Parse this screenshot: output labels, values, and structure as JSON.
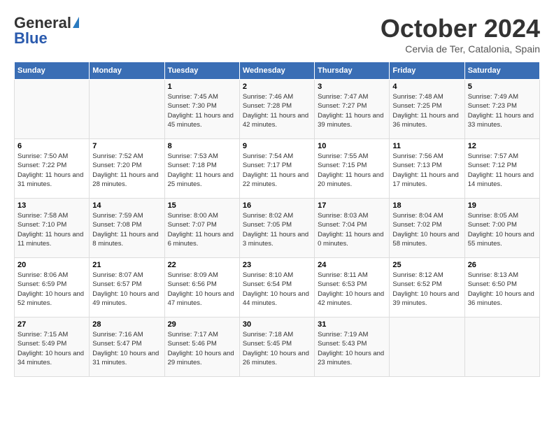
{
  "header": {
    "logo_general": "General",
    "logo_blue": "Blue",
    "month_title": "October 2024",
    "location": "Cervia de Ter, Catalonia, Spain"
  },
  "weekdays": [
    "Sunday",
    "Monday",
    "Tuesday",
    "Wednesday",
    "Thursday",
    "Friday",
    "Saturday"
  ],
  "weeks": [
    [
      {
        "day": "",
        "sunrise": "",
        "sunset": "",
        "daylight": ""
      },
      {
        "day": "",
        "sunrise": "",
        "sunset": "",
        "daylight": ""
      },
      {
        "day": "1",
        "sunrise": "Sunrise: 7:45 AM",
        "sunset": "Sunset: 7:30 PM",
        "daylight": "Daylight: 11 hours and 45 minutes."
      },
      {
        "day": "2",
        "sunrise": "Sunrise: 7:46 AM",
        "sunset": "Sunset: 7:28 PM",
        "daylight": "Daylight: 11 hours and 42 minutes."
      },
      {
        "day": "3",
        "sunrise": "Sunrise: 7:47 AM",
        "sunset": "Sunset: 7:27 PM",
        "daylight": "Daylight: 11 hours and 39 minutes."
      },
      {
        "day": "4",
        "sunrise": "Sunrise: 7:48 AM",
        "sunset": "Sunset: 7:25 PM",
        "daylight": "Daylight: 11 hours and 36 minutes."
      },
      {
        "day": "5",
        "sunrise": "Sunrise: 7:49 AM",
        "sunset": "Sunset: 7:23 PM",
        "daylight": "Daylight: 11 hours and 33 minutes."
      }
    ],
    [
      {
        "day": "6",
        "sunrise": "Sunrise: 7:50 AM",
        "sunset": "Sunset: 7:22 PM",
        "daylight": "Daylight: 11 hours and 31 minutes."
      },
      {
        "day": "7",
        "sunrise": "Sunrise: 7:52 AM",
        "sunset": "Sunset: 7:20 PM",
        "daylight": "Daylight: 11 hours and 28 minutes."
      },
      {
        "day": "8",
        "sunrise": "Sunrise: 7:53 AM",
        "sunset": "Sunset: 7:18 PM",
        "daylight": "Daylight: 11 hours and 25 minutes."
      },
      {
        "day": "9",
        "sunrise": "Sunrise: 7:54 AM",
        "sunset": "Sunset: 7:17 PM",
        "daylight": "Daylight: 11 hours and 22 minutes."
      },
      {
        "day": "10",
        "sunrise": "Sunrise: 7:55 AM",
        "sunset": "Sunset: 7:15 PM",
        "daylight": "Daylight: 11 hours and 20 minutes."
      },
      {
        "day": "11",
        "sunrise": "Sunrise: 7:56 AM",
        "sunset": "Sunset: 7:13 PM",
        "daylight": "Daylight: 11 hours and 17 minutes."
      },
      {
        "day": "12",
        "sunrise": "Sunrise: 7:57 AM",
        "sunset": "Sunset: 7:12 PM",
        "daylight": "Daylight: 11 hours and 14 minutes."
      }
    ],
    [
      {
        "day": "13",
        "sunrise": "Sunrise: 7:58 AM",
        "sunset": "Sunset: 7:10 PM",
        "daylight": "Daylight: 11 hours and 11 minutes."
      },
      {
        "day": "14",
        "sunrise": "Sunrise: 7:59 AM",
        "sunset": "Sunset: 7:08 PM",
        "daylight": "Daylight: 11 hours and 8 minutes."
      },
      {
        "day": "15",
        "sunrise": "Sunrise: 8:00 AM",
        "sunset": "Sunset: 7:07 PM",
        "daylight": "Daylight: 11 hours and 6 minutes."
      },
      {
        "day": "16",
        "sunrise": "Sunrise: 8:02 AM",
        "sunset": "Sunset: 7:05 PM",
        "daylight": "Daylight: 11 hours and 3 minutes."
      },
      {
        "day": "17",
        "sunrise": "Sunrise: 8:03 AM",
        "sunset": "Sunset: 7:04 PM",
        "daylight": "Daylight: 11 hours and 0 minutes."
      },
      {
        "day": "18",
        "sunrise": "Sunrise: 8:04 AM",
        "sunset": "Sunset: 7:02 PM",
        "daylight": "Daylight: 10 hours and 58 minutes."
      },
      {
        "day": "19",
        "sunrise": "Sunrise: 8:05 AM",
        "sunset": "Sunset: 7:00 PM",
        "daylight": "Daylight: 10 hours and 55 minutes."
      }
    ],
    [
      {
        "day": "20",
        "sunrise": "Sunrise: 8:06 AM",
        "sunset": "Sunset: 6:59 PM",
        "daylight": "Daylight: 10 hours and 52 minutes."
      },
      {
        "day": "21",
        "sunrise": "Sunrise: 8:07 AM",
        "sunset": "Sunset: 6:57 PM",
        "daylight": "Daylight: 10 hours and 49 minutes."
      },
      {
        "day": "22",
        "sunrise": "Sunrise: 8:09 AM",
        "sunset": "Sunset: 6:56 PM",
        "daylight": "Daylight: 10 hours and 47 minutes."
      },
      {
        "day": "23",
        "sunrise": "Sunrise: 8:10 AM",
        "sunset": "Sunset: 6:54 PM",
        "daylight": "Daylight: 10 hours and 44 minutes."
      },
      {
        "day": "24",
        "sunrise": "Sunrise: 8:11 AM",
        "sunset": "Sunset: 6:53 PM",
        "daylight": "Daylight: 10 hours and 42 minutes."
      },
      {
        "day": "25",
        "sunrise": "Sunrise: 8:12 AM",
        "sunset": "Sunset: 6:52 PM",
        "daylight": "Daylight: 10 hours and 39 minutes."
      },
      {
        "day": "26",
        "sunrise": "Sunrise: 8:13 AM",
        "sunset": "Sunset: 6:50 PM",
        "daylight": "Daylight: 10 hours and 36 minutes."
      }
    ],
    [
      {
        "day": "27",
        "sunrise": "Sunrise: 7:15 AM",
        "sunset": "Sunset: 5:49 PM",
        "daylight": "Daylight: 10 hours and 34 minutes."
      },
      {
        "day": "28",
        "sunrise": "Sunrise: 7:16 AM",
        "sunset": "Sunset: 5:47 PM",
        "daylight": "Daylight: 10 hours and 31 minutes."
      },
      {
        "day": "29",
        "sunrise": "Sunrise: 7:17 AM",
        "sunset": "Sunset: 5:46 PM",
        "daylight": "Daylight: 10 hours and 29 minutes."
      },
      {
        "day": "30",
        "sunrise": "Sunrise: 7:18 AM",
        "sunset": "Sunset: 5:45 PM",
        "daylight": "Daylight: 10 hours and 26 minutes."
      },
      {
        "day": "31",
        "sunrise": "Sunrise: 7:19 AM",
        "sunset": "Sunset: 5:43 PM",
        "daylight": "Daylight: 10 hours and 23 minutes."
      },
      {
        "day": "",
        "sunrise": "",
        "sunset": "",
        "daylight": ""
      },
      {
        "day": "",
        "sunrise": "",
        "sunset": "",
        "daylight": ""
      }
    ]
  ]
}
